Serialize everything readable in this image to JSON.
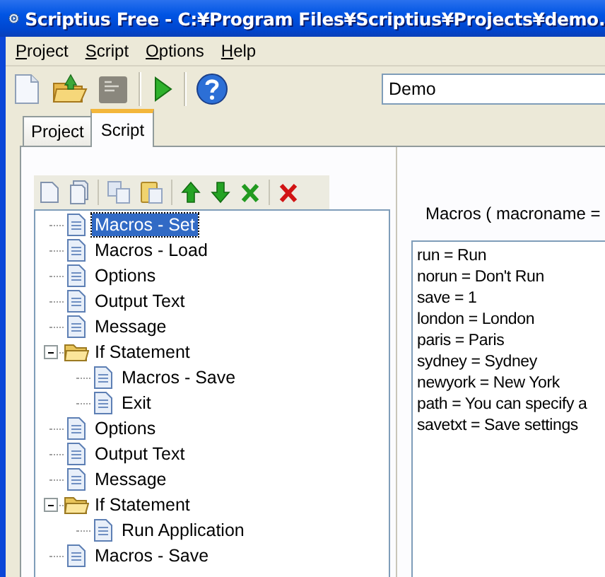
{
  "window": {
    "title": "Scriptius Free - C:¥Program Files¥Scriptius¥Projects¥demo."
  },
  "menu": [
    {
      "label": "Project"
    },
    {
      "label": "Script"
    },
    {
      "label": "Options"
    },
    {
      "label": "Help"
    }
  ],
  "toolbar": {
    "project_field": {
      "value": "Demo"
    }
  },
  "tabs": [
    {
      "label": "Project",
      "selected": false
    },
    {
      "label": "Script",
      "selected": true
    }
  ],
  "tree": [
    {
      "label": "Macros - Set",
      "kind": "item",
      "selected": true
    },
    {
      "label": "Macros - Load",
      "kind": "item",
      "selected": false
    },
    {
      "label": "Options",
      "kind": "item",
      "selected": false
    },
    {
      "label": "Output Text",
      "kind": "item",
      "selected": false
    },
    {
      "label": "Message",
      "kind": "item",
      "selected": false
    },
    {
      "label": "If Statement",
      "kind": "folder",
      "selected": false,
      "expanded": true,
      "children": [
        {
          "label": "Macros - Save",
          "kind": "item",
          "selected": false
        },
        {
          "label": "Exit",
          "kind": "item",
          "selected": false
        }
      ]
    },
    {
      "label": "Options",
      "kind": "item",
      "selected": false
    },
    {
      "label": "Output Text",
      "kind": "item",
      "selected": false
    },
    {
      "label": "Message",
      "kind": "item",
      "selected": false
    },
    {
      "label": "If Statement",
      "kind": "folder",
      "selected": false,
      "expanded": true,
      "children": [
        {
          "label": "Run Application",
          "kind": "item",
          "selected": false
        }
      ]
    },
    {
      "label": "Macros - Save",
      "kind": "item",
      "selected": false
    }
  ],
  "editor": {
    "label": "Macros ( macroname =",
    "lines": [
      "run = Run",
      "norun = Don't Run",
      "save = 1",
      "london = London",
      "paris = Paris",
      "sydney = Sydney",
      "newyork = New York",
      "path = You can specify a",
      "savetxt = Save settings"
    ]
  }
}
